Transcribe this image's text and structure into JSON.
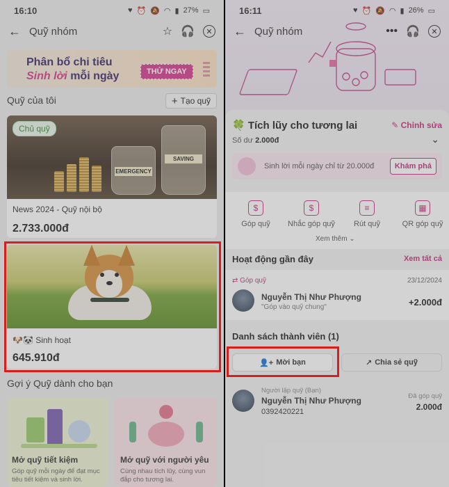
{
  "left": {
    "status": {
      "time": "16:10",
      "battery": "27%"
    },
    "header": {
      "title": "Quỹ nhóm"
    },
    "banner": {
      "line1": "Phân bổ chi tiêu",
      "line2_italic": "Sinh lời",
      "line2_rest": " mỗi ngày",
      "cta": "THỬ NGAY"
    },
    "my_funds": {
      "title": "Quỹ của tôi",
      "create_label": "Tạo quỹ",
      "cards": [
        {
          "badge": "Chủ quỹ",
          "name": "News 2024 - Quỹ nội bộ",
          "amount": "2.733.000đ",
          "jar_labels": [
            "EMERGENCY",
            "SAVING"
          ]
        },
        {
          "name": "🐶🐼 Sinh hoạt",
          "amount": "645.910đ"
        }
      ]
    },
    "suggestions": {
      "title": "Gợi ý Quỹ dành cho bạn",
      "cards": [
        {
          "title": "Mở quỹ tiết kiệm",
          "desc": "Góp quỹ mỗi ngày để đạt mục tiêu tiết kiệm và sinh lời."
        },
        {
          "title": "Mở quỹ với người yêu",
          "desc": "Cùng nhau tích lũy, cùng vun đắp cho tương lai."
        }
      ]
    }
  },
  "right": {
    "status": {
      "time": "16:11",
      "battery": "26%"
    },
    "header": {
      "title": "Quỹ nhóm"
    },
    "fund": {
      "title": "🍀 Tích lũy cho tương lai",
      "edit_label": "Chỉnh sửa",
      "balance_label": "Số dư",
      "balance_value": "2.000đ"
    },
    "promo": {
      "text": "Sinh lời mỗi ngày chỉ từ 20.000đ",
      "button": "Khám phá"
    },
    "actions": [
      {
        "label": "Góp quỹ",
        "icon": "money-hand-icon"
      },
      {
        "label": "Nhắc góp quỹ",
        "icon": "reminder-icon"
      },
      {
        "label": "Rút quỹ",
        "icon": "withdraw-icon"
      },
      {
        "label": "QR góp quỹ",
        "icon": "qr-icon"
      }
    ],
    "see_more": "Xem thêm",
    "recent": {
      "title": "Hoạt động gần đây",
      "see_all": "Xem tất cả",
      "item": {
        "tag": "Góp quỹ",
        "date": "23/12/2024",
        "name": "Nguyễn Thị Như Phượng",
        "note": "\"Góp vào quỹ chung\"",
        "amount": "+2.000đ"
      }
    },
    "members": {
      "title": "Danh sách thành viên (1)",
      "invite_label": "Mời bạn",
      "share_label": "Chia sẻ quỹ",
      "list": [
        {
          "role": "Người lập quỹ (Bạn)",
          "name": "Nguyễn Thị Như Phượng",
          "phone": "0392420221",
          "contrib_label": "Đã góp quỹ",
          "contrib_amount": "2.000đ"
        }
      ]
    }
  },
  "colors": {
    "accent": "#c1307d",
    "highlight": "#d91c1c"
  }
}
